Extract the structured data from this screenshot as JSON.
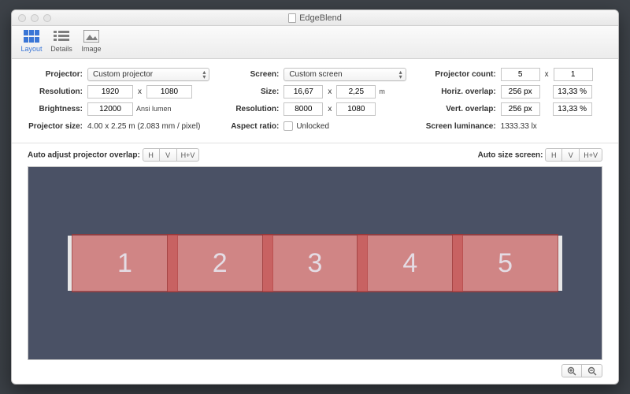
{
  "window": {
    "title": "EdgeBlend"
  },
  "toolbar": {
    "layout": "Layout",
    "details": "Details",
    "image": "Image"
  },
  "settings": {
    "projector": {
      "projector_label": "Projector:",
      "projector_value": "Custom projector",
      "resolution_label": "Resolution:",
      "res_w": "1920",
      "res_h": "1080",
      "brightness_label": "Brightness:",
      "brightness_value": "12000",
      "brightness_unit": "Ansi lumen",
      "size_label": "Projector size:",
      "size_value": "4.00 x 2.25 m (2.083 mm / pixel)"
    },
    "screen": {
      "screen_label": "Screen:",
      "screen_value": "Custom screen",
      "size_label": "Size:",
      "size_w": "16,67",
      "size_h": "2,25",
      "size_unit": "m",
      "resolution_label": "Resolution:",
      "res_w": "8000",
      "res_h": "1080",
      "aspect_label": "Aspect ratio:",
      "aspect_value": "Unlocked"
    },
    "layout": {
      "count_label": "Projector count:",
      "count_x": "5",
      "count_y": "1",
      "hoverlap_label": "Horiz. overlap:",
      "hoverlap_px": "256 px",
      "hoverlap_pct": "13,33 %",
      "voverlap_label": "Vert. overlap:",
      "voverlap_px": "256 px",
      "voverlap_pct": "13,33 %",
      "luminance_label": "Screen luminance:",
      "luminance_value": "1333.33 lx"
    }
  },
  "adjust": {
    "auto_overlap_label": "Auto adjust projector overlap:",
    "auto_size_label": "Auto size screen:",
    "H": "H",
    "V": "V",
    "HV": "H+V"
  },
  "projectors": [
    "1",
    "2",
    "3",
    "4",
    "5"
  ]
}
